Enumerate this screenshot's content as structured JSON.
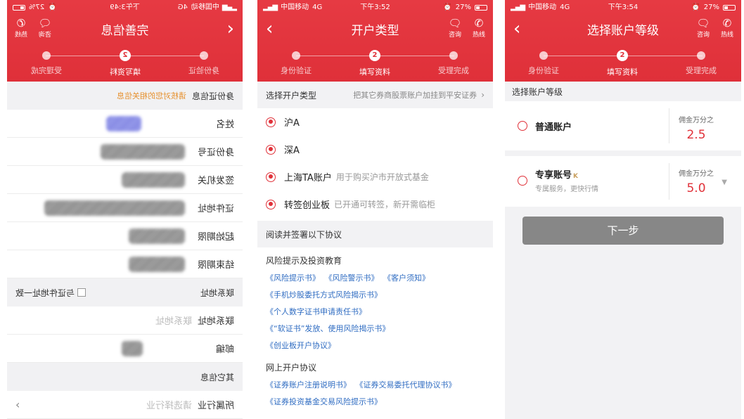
{
  "phone1": {
    "status": {
      "carrier": "中国移动",
      "network": "4G",
      "time": "下午3:49",
      "battery": "27%"
    },
    "title": "完善信息",
    "icons": [
      {
        "label": "热线",
        "icon": "phone-icon"
      },
      {
        "label": "咨询",
        "icon": "chat-icon"
      }
    ],
    "steps": [
      "身份验证",
      "填写资料",
      "受理完成"
    ],
    "active_step_num": "2",
    "id_section": {
      "title": "身份证信息",
      "note": "请核对您的相关信息"
    },
    "fields": [
      {
        "label": "姓名"
      },
      {
        "label": "身份证号"
      },
      {
        "label": "签发机关"
      },
      {
        "label": "证件地址"
      },
      {
        "label": "起始期限"
      },
      {
        "label": "结束期限"
      }
    ],
    "contact_section": {
      "title": "联系地址",
      "checkbox_label": "与证件地址一致"
    },
    "contact_fields": [
      {
        "label": "联系地址",
        "placeholder": "联系地址"
      },
      {
        "label": "邮编"
      }
    ],
    "other_section": {
      "title": "其它信息"
    },
    "industry": {
      "label": "所属行业",
      "placeholder": "请选择行业"
    }
  },
  "phone2": {
    "status": {
      "carrier": "中国移动",
      "network": "4G",
      "time": "下午3:52",
      "battery": "27%"
    },
    "title": "开户类型",
    "icons": [
      {
        "label": "咨询",
        "icon": "chat-icon"
      },
      {
        "label": "热线",
        "icon": "phone-icon"
      }
    ],
    "steps": [
      "身份验证",
      "填写资料",
      "受理完成"
    ],
    "active_step_num": "2",
    "select_label": "选择开户类型",
    "select_hint": "把其它券商股票账户加挂到平安证券",
    "options": [
      {
        "name": "沪A",
        "desc": ""
      },
      {
        "name": "深A",
        "desc": ""
      },
      {
        "name": "上海TA账户",
        "desc": "用于购买沪市开放式基金"
      },
      {
        "name": "转签创业板",
        "desc": "已开通可转签，新开需临柜"
      }
    ],
    "agreements_header": "阅读并签署以下协议",
    "risk_title": "风险提示及投资教育",
    "risk_links": [
      [
        "《风险提示书》",
        "《风险警示书》",
        "《客户须知》"
      ],
      [
        "《手机炒股委托方式风险揭示书》"
      ],
      [
        "《个人数字证书申请责任书》"
      ],
      [
        "《“软证书”发放、使用风险揭示书》"
      ],
      [
        "《创业板开户协议》"
      ]
    ],
    "online_title": "网上开户协议",
    "online_links": [
      [
        "《证券账户注册说明书》",
        "《证券交易委托代理协议书》"
      ],
      [
        "《证券投资基金交易风险提示书》"
      ]
    ]
  },
  "phone3": {
    "status": {
      "carrier": "中国移动",
      "network": "4G",
      "time": "下午3:54",
      "battery": "27%"
    },
    "title": "选择账户等级",
    "icons": [
      {
        "label": "咨询",
        "icon": "chat-icon"
      },
      {
        "label": "热线",
        "icon": "phone-icon"
      }
    ],
    "steps": [
      "身份验证",
      "填写资料",
      "受理完成"
    ],
    "active_step_num": "2",
    "section_label": "选择账户等级",
    "accounts": [
      {
        "name": "普通账户",
        "subtitle": "",
        "rate_label": "佣金万分之",
        "rate": "2.5"
      },
      {
        "name": "专享账号",
        "badge": "K",
        "subtitle": "专属服务，更快行情",
        "rate_label": "佣金万分之",
        "rate": "5.0"
      }
    ],
    "next_button": "下一步"
  }
}
